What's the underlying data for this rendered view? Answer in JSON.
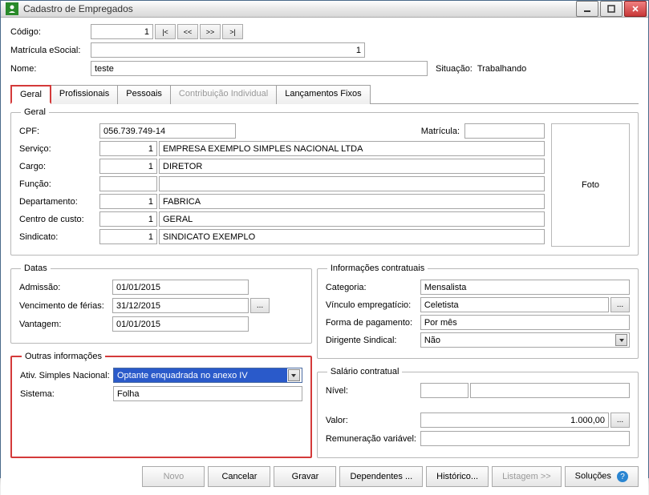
{
  "window": {
    "title": "Cadastro de Empregados"
  },
  "header": {
    "codigo_label": "Código:",
    "codigo_value": "1",
    "nav": {
      "first": "|<",
      "prev": "<<",
      "next": ">>",
      "last": ">|"
    },
    "matricula_esocial_label": "Matrícula eSocial:",
    "matricula_esocial_value": "1",
    "nome_label": "Nome:",
    "nome_value": "teste",
    "situacao_label": "Situação:",
    "situacao_value": "Trabalhando"
  },
  "tabs": {
    "geral": "Geral",
    "profissionais": "Profissionais",
    "pessoais": "Pessoais",
    "contribuicao": "Contribuição Individual",
    "lancamentos": "Lançamentos Fixos"
  },
  "geral": {
    "legend": "Geral",
    "cpf_label": "CPF:",
    "cpf_value": "056.739.749-14",
    "matricula_label": "Matrícula:",
    "matricula_value": "",
    "servico": {
      "label": "Serviço:",
      "code": "1",
      "desc": "EMPRESA EXEMPLO SIMPLES NACIONAL LTDA"
    },
    "cargo": {
      "label": "Cargo:",
      "code": "1",
      "desc": "DIRETOR"
    },
    "funcao": {
      "label": "Função:",
      "code": "",
      "desc": ""
    },
    "departamento": {
      "label": "Departamento:",
      "code": "1",
      "desc": "FABRICA"
    },
    "centro_custo": {
      "label": "Centro de custo:",
      "code": "1",
      "desc": "GERAL"
    },
    "sindicato": {
      "label": "Sindicato:",
      "code": "1",
      "desc": "SINDICATO EXEMPLO"
    },
    "foto": "Foto"
  },
  "datas": {
    "legend": "Datas",
    "admissao": {
      "label": "Admissão:",
      "value": "01/01/2015"
    },
    "vencimento": {
      "label": "Vencimento de férias:",
      "value": "31/12/2015"
    },
    "vantagem": {
      "label": "Vantagem:",
      "value": "01/01/2015"
    }
  },
  "contratuais": {
    "legend": "Informações contratuais",
    "categoria": {
      "label": "Categoria:",
      "value": "Mensalista"
    },
    "vinculo": {
      "label": "Vínculo empregatício:",
      "value": "Celetista"
    },
    "pagamento": {
      "label": "Forma de pagamento:",
      "value": "Por mês"
    },
    "dirigente": {
      "label": "Dirigente Sindical:",
      "value": "Não"
    }
  },
  "outras": {
    "legend": "Outras informações",
    "ativ_simples": {
      "label": "Ativ. Simples Nacional:",
      "value": "Optante enquadrada no anexo IV"
    },
    "sistema": {
      "label": "Sistema:",
      "value": "Folha"
    }
  },
  "salario": {
    "legend": "Salário contratual",
    "nivel": {
      "label": "Nível:",
      "value1": "",
      "value2": ""
    },
    "valor": {
      "label": "Valor:",
      "value": "1.000,00"
    },
    "remuneracao": {
      "label": "Remuneração variável:",
      "value": ""
    }
  },
  "footer": {
    "novo": "Novo",
    "cancelar": "Cancelar",
    "gravar": "Gravar",
    "dependentes": "Dependentes ...",
    "historico": "Histórico...",
    "listagem": "Listagem >>",
    "solucoes": "Soluções"
  },
  "ellipsis": "..."
}
